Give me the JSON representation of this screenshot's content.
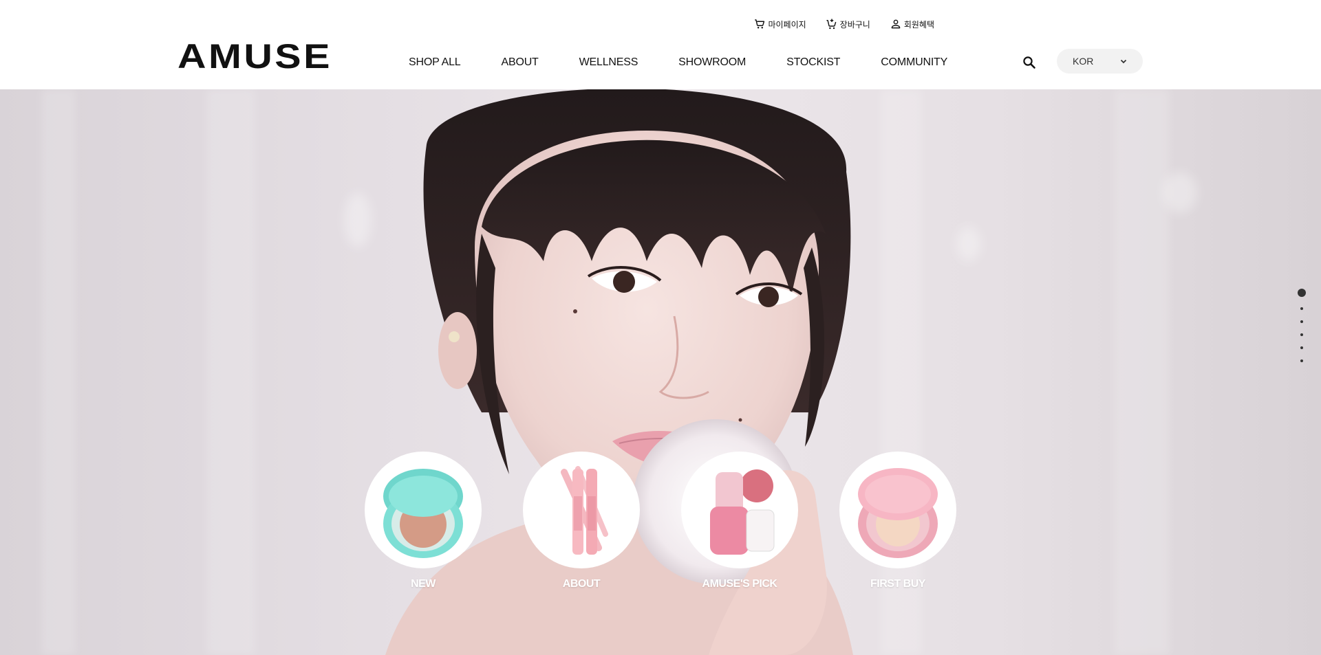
{
  "header": {
    "logo": "AMUSE",
    "nav": [
      "SHOP ALL",
      "ABOUT",
      "WELLNESS",
      "SHOWROOM",
      "STOCKIST",
      "COMMUNITY"
    ],
    "util": {
      "mypage": "마이페이지",
      "cart": "장바구니",
      "benefits": "회원혜택"
    },
    "language": "KOR"
  },
  "hero": {
    "slides_total": 6,
    "active_slide": 1,
    "quick_links": [
      {
        "label": "NEW",
        "product_icon": "cushion-compact-mint"
      },
      {
        "label": "ABOUT",
        "product_icon": "lip-liner-pencils"
      },
      {
        "label": "AMUSE'S PICK",
        "product_icon": "lip-tint-bottle"
      },
      {
        "label": "FIRST BUY",
        "product_icon": "cushion-compact-pink"
      }
    ]
  },
  "colors": {
    "text": "#111111",
    "hero_bg": "#e6e0e4",
    "lang_bg": "#f2f2f2"
  }
}
